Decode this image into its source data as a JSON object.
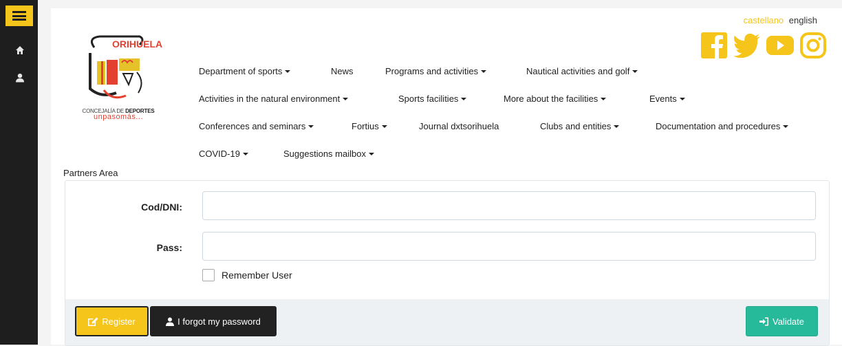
{
  "sidebar": {
    "menu_icon": "hamburger-icon",
    "items": [
      {
        "icon": "home-icon"
      },
      {
        "icon": "user-icon"
      }
    ]
  },
  "header": {
    "logo": {
      "title": "ORIHUELA",
      "line1_prefix": "CONCEJALÍA DE ",
      "line1_bold": "DEPORTES",
      "line2": "unpasomás..."
    },
    "languages": {
      "spanish": "castellano",
      "english": "english"
    },
    "social_icons": [
      "facebook-icon",
      "twitter-icon",
      "youtube-icon",
      "instagram-icon"
    ],
    "accent_color": "#f5c51c"
  },
  "nav": {
    "rows": [
      [
        {
          "label": "Department of sports",
          "dropdown": true
        },
        {
          "label": "News",
          "dropdown": false
        },
        {
          "label": "Programs and activities",
          "dropdown": true
        },
        {
          "label": "Nautical activities and golf",
          "dropdown": true
        }
      ],
      [
        {
          "label": "Activities in the natural environment",
          "dropdown": true
        },
        {
          "label": "Sports facilities",
          "dropdown": true
        },
        {
          "label": "More about the facilities",
          "dropdown": true
        },
        {
          "label": "Events",
          "dropdown": true
        }
      ],
      [
        {
          "label": "Conferences and seminars",
          "dropdown": true
        },
        {
          "label": "Fortius",
          "dropdown": true
        },
        {
          "label": "Journal dxtsorihuela",
          "dropdown": false
        },
        {
          "label": "Clubs and entities",
          "dropdown": true
        },
        {
          "label": "Documentation and procedures",
          "dropdown": true
        }
      ],
      [
        {
          "label": "COVID-19",
          "dropdown": true
        },
        {
          "label": "Suggestions mailbox",
          "dropdown": true
        }
      ]
    ]
  },
  "partners": {
    "title": "Partners Area",
    "form": {
      "cod_label": "Cod/DNI:",
      "cod_value": "",
      "pass_label": "Pass:",
      "pass_value": "",
      "remember_label": "Remember User",
      "remember_checked": false
    },
    "buttons": {
      "register": "Register",
      "forgot": "I forgot my password",
      "validate": "Validate"
    },
    "colors": {
      "validate": "#26b99a",
      "register": "#f5c51c",
      "forgot": "#222222"
    }
  }
}
